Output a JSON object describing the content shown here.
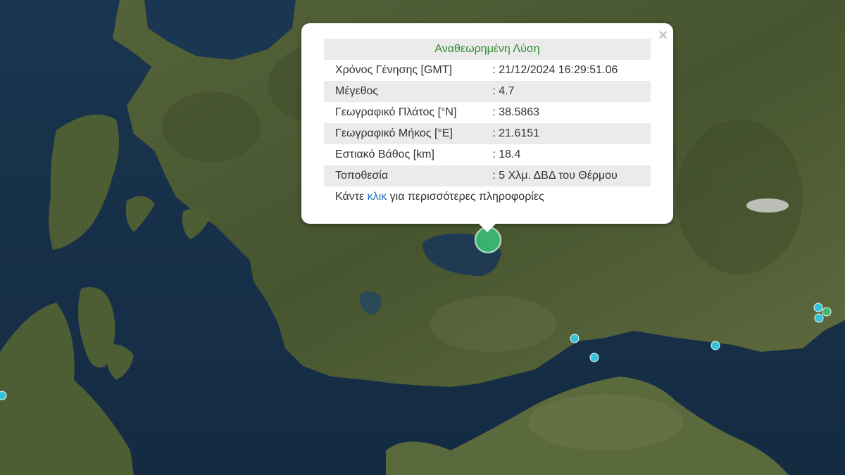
{
  "popup": {
    "title": "Αναθεωρημένη Λύση",
    "close_symbol": "×",
    "rows": [
      {
        "label": "Χρόνος Γένησης [GMT]",
        "value": ": 21/12/2024 16:29:51.06"
      },
      {
        "label": "Μέγεθος",
        "value": ": 4.7"
      },
      {
        "label": "Γεωγραφικό Πλάτος [°N]",
        "value": ": 38.5863"
      },
      {
        "label": "Γεωγραφικό Μήκος [°E]",
        "value": ": 21.6151"
      },
      {
        "label": "Εστιακό Βάθος [km]",
        "value": ": 18.4"
      },
      {
        "label": "Τοποθεσία",
        "value": ": 5 Χλμ. ΔΒΔ του Θέρμου"
      }
    ],
    "more_info_before": "Κάντε ",
    "more_info_link": "κλικ",
    "more_info_after": " για περισσότερες πληροφορίες"
  },
  "colors": {
    "sea": "#17314a",
    "land": "#4b5a33",
    "main_event": "#3db873",
    "other_event": "#34c3d9",
    "title_green": "#2e8b2e",
    "link_blue": "#1f6fc4"
  },
  "icons": {
    "close": "close-icon",
    "main_event": "earthquake-marker-icon",
    "other_event": "earthquake-marker-icon"
  }
}
